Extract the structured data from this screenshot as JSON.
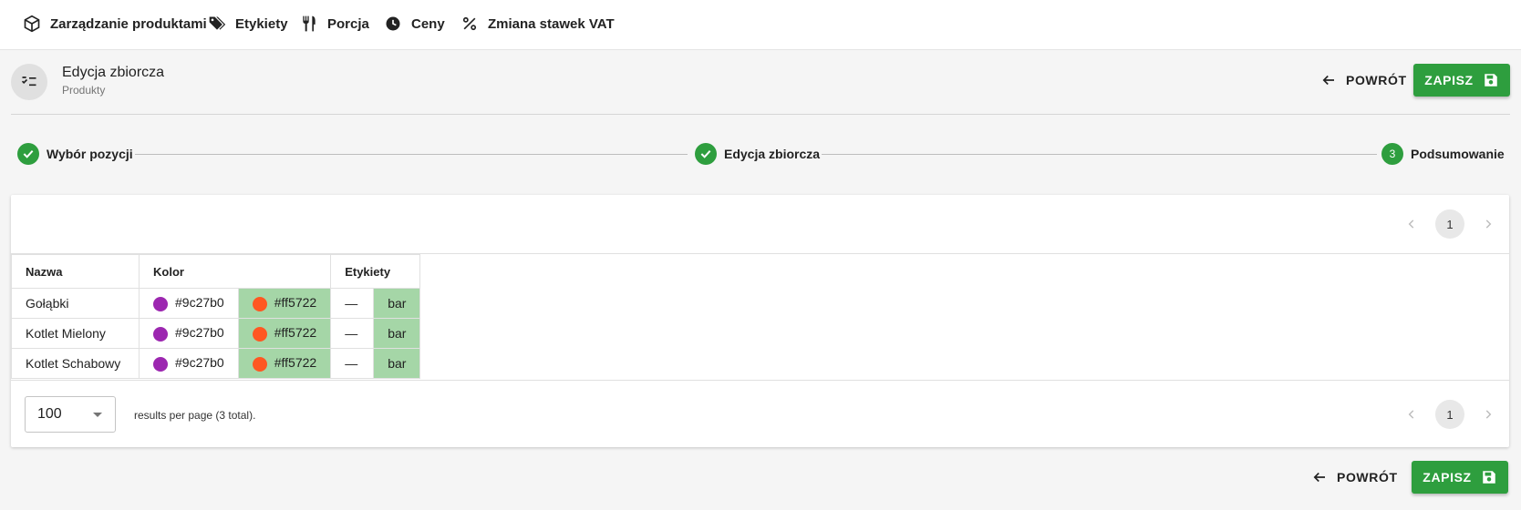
{
  "nav": {
    "items": [
      {
        "label": "Zarządzanie produktami",
        "icon": "cube-icon"
      },
      {
        "label": "Etykiety",
        "icon": "tag-icon"
      },
      {
        "label": "Porcja",
        "icon": "cutlery-icon"
      },
      {
        "label": "Ceny",
        "icon": "clock-icon"
      },
      {
        "label": "Zmiana stawek VAT",
        "icon": "percent-icon"
      }
    ]
  },
  "header": {
    "title": "Edycja zbiorcza",
    "subtitle": "Produkty",
    "icon": "checklist-icon",
    "back_label": "POWRÓT",
    "save_label": "ZAPISZ"
  },
  "stepper": {
    "steps": [
      {
        "label": "Wybór pozycji",
        "state": "done"
      },
      {
        "label": "Edycja zbiorcza",
        "state": "done"
      },
      {
        "label": "Podsumowanie",
        "state": "active",
        "number": "3"
      }
    ]
  },
  "pagination": {
    "current_page": "1"
  },
  "table": {
    "columns": [
      "Nazwa",
      "Kolor",
      "Etykiety"
    ],
    "rows": [
      {
        "name": "Gołąbki",
        "color_old": "#9c27b0",
        "color_new": "#ff5722",
        "tag_old": "—",
        "tag_new": "bar"
      },
      {
        "name": "Kotlet Mielony",
        "color_old": "#9c27b0",
        "color_new": "#ff5722",
        "tag_old": "—",
        "tag_new": "bar"
      },
      {
        "name": "Kotlet Schabowy",
        "color_old": "#9c27b0",
        "color_new": "#ff5722",
        "tag_old": "—",
        "tag_new": "bar"
      }
    ]
  },
  "footer": {
    "per_page": "100",
    "results_text": "results per page (3 total)."
  },
  "colors": {
    "accent": "#2e9e3e",
    "highlight": "#a5d6a7"
  }
}
